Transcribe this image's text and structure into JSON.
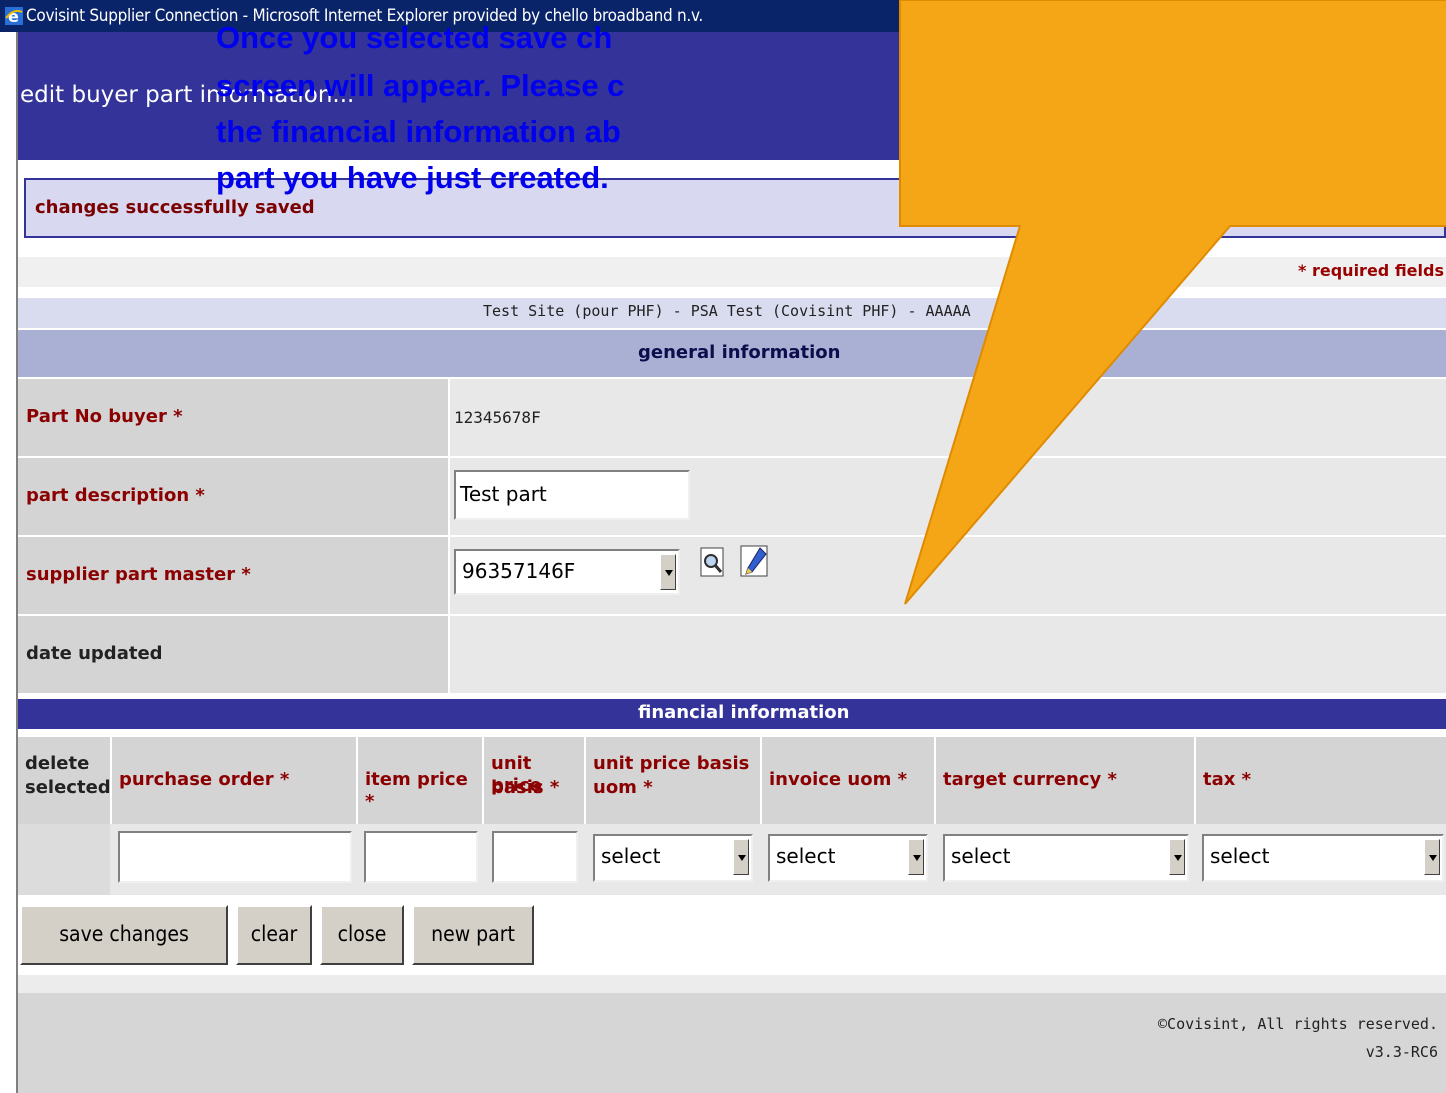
{
  "window": {
    "title": "Covisint Supplier Connection - Microsoft Internet Explorer provided by chello broadband n.v."
  },
  "page": {
    "heading": "edit buyer part information...",
    "status_message": "changes successfully saved",
    "required_note": "* required fields",
    "site_line": "Test Site (pour PHF) - PSA Test (Covisint PHF) - AAAAA"
  },
  "general": {
    "title": "general information",
    "part_no_label": "Part No buyer *",
    "part_no_value": "12345678F",
    "part_desc_label": "part description *",
    "part_desc_value": "Test part",
    "supplier_master_label": "supplier part master *",
    "supplier_master_value": "96357146F",
    "date_updated_label": "date updated"
  },
  "financial": {
    "title": "financial information",
    "columns": {
      "delete_1": "delete",
      "delete_2": "selected",
      "purchase_order": "purchase order *",
      "item_price": "item price *",
      "unit_price_basis_1": "unit price",
      "unit_price_basis_2": "basis *",
      "unit_price_basis_uom_1": "unit price basis",
      "unit_price_basis_uom_2": "uom *",
      "invoice_uom": "invoice uom *",
      "target_currency": "target currency *",
      "tax": "tax *"
    },
    "select_placeholder": "select"
  },
  "buttons": {
    "save": "save changes",
    "clear": "clear",
    "close": "close",
    "new_part": "new part"
  },
  "footer": {
    "copyright": "©Covisint, All rights reserved.",
    "version": "v3.3-RC6"
  },
  "callout": {
    "line1": "Once you selected save ch",
    "line2": "screen will appear. Please c",
    "line3": "the financial information ab",
    "line4": "part you have just created.",
    "fill": "#f5a617",
    "border": "#e08a00",
    "text_color": "#0000ee"
  },
  "colors": {
    "title_bar": "#0a246a",
    "header_blue": "#333399",
    "label_red": "#8b0000"
  }
}
